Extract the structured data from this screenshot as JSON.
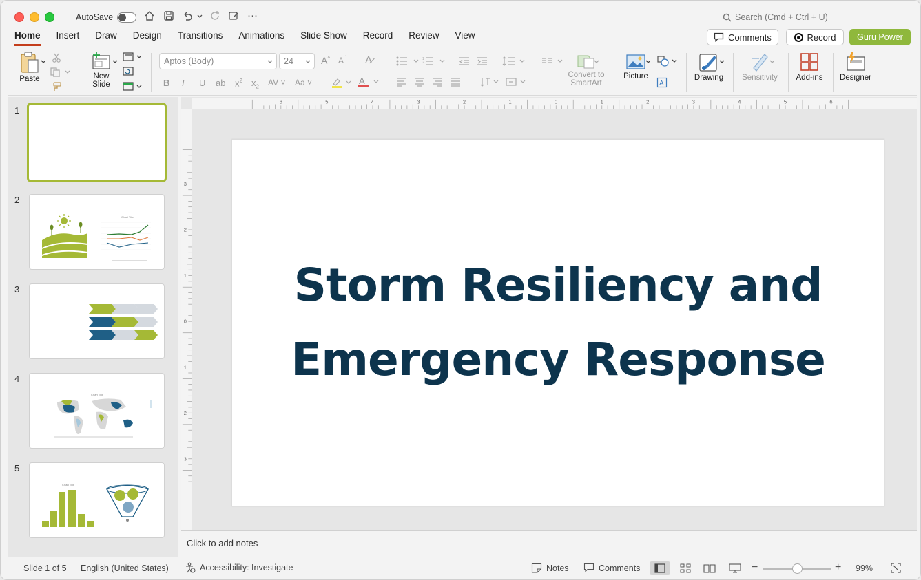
{
  "titlebar": {
    "autosave_label": "AutoSave",
    "search_placeholder": "Search (Cmd + Ctrl + U)"
  },
  "tabs": [
    {
      "label": "Home",
      "active": true
    },
    {
      "label": "Insert"
    },
    {
      "label": "Draw"
    },
    {
      "label": "Design"
    },
    {
      "label": "Transitions"
    },
    {
      "label": "Animations"
    },
    {
      "label": "Slide Show"
    },
    {
      "label": "Record"
    },
    {
      "label": "Review"
    },
    {
      "label": "View"
    }
  ],
  "header_buttons": {
    "comments": "Comments",
    "record": "Record",
    "guru": "Guru Power"
  },
  "ribbon": {
    "paste": "Paste",
    "new_slide_line1": "New",
    "new_slide_line2": "Slide",
    "font_name": "Aptos (Body)",
    "font_size": "24",
    "convert_line1": "Convert to",
    "convert_line2": "SmartArt",
    "picture": "Picture",
    "drawing": "Drawing",
    "sensitivity": "Sensitivity",
    "addins": "Add-ins",
    "designer": "Designer"
  },
  "thumbnails": [
    {
      "number": "1",
      "selected": true
    },
    {
      "number": "2"
    },
    {
      "number": "3"
    },
    {
      "number": "4"
    },
    {
      "number": "5"
    }
  ],
  "thumb_titles": {
    "chart": "Chart Title"
  },
  "slide": {
    "title_line1": "Storm Resiliency and",
    "title_line2": "Emergency Response"
  },
  "ruler": {
    "h_labels": [
      "6",
      "5",
      "4",
      "3",
      "2",
      "1",
      "0",
      "1",
      "2",
      "3",
      "4",
      "5",
      "6"
    ],
    "v_labels": [
      "3",
      "2",
      "1",
      "0",
      "1",
      "2",
      "3"
    ]
  },
  "notes": {
    "placeholder": "Click to add notes"
  },
  "statusbar": {
    "slide_counter": "Slide 1 of 5",
    "language": "English (United States)",
    "accessibility": "Accessibility: Investigate",
    "notes": "Notes",
    "comments": "Comments",
    "zoom": "99%",
    "zoom_level": 0.5
  },
  "colors": {
    "accent_green": "#8fb83c",
    "selected_border": "#a5b936",
    "title_navy": "#0d344d",
    "tab_underline": "#c43e1c",
    "teal": "#1f5f86"
  }
}
